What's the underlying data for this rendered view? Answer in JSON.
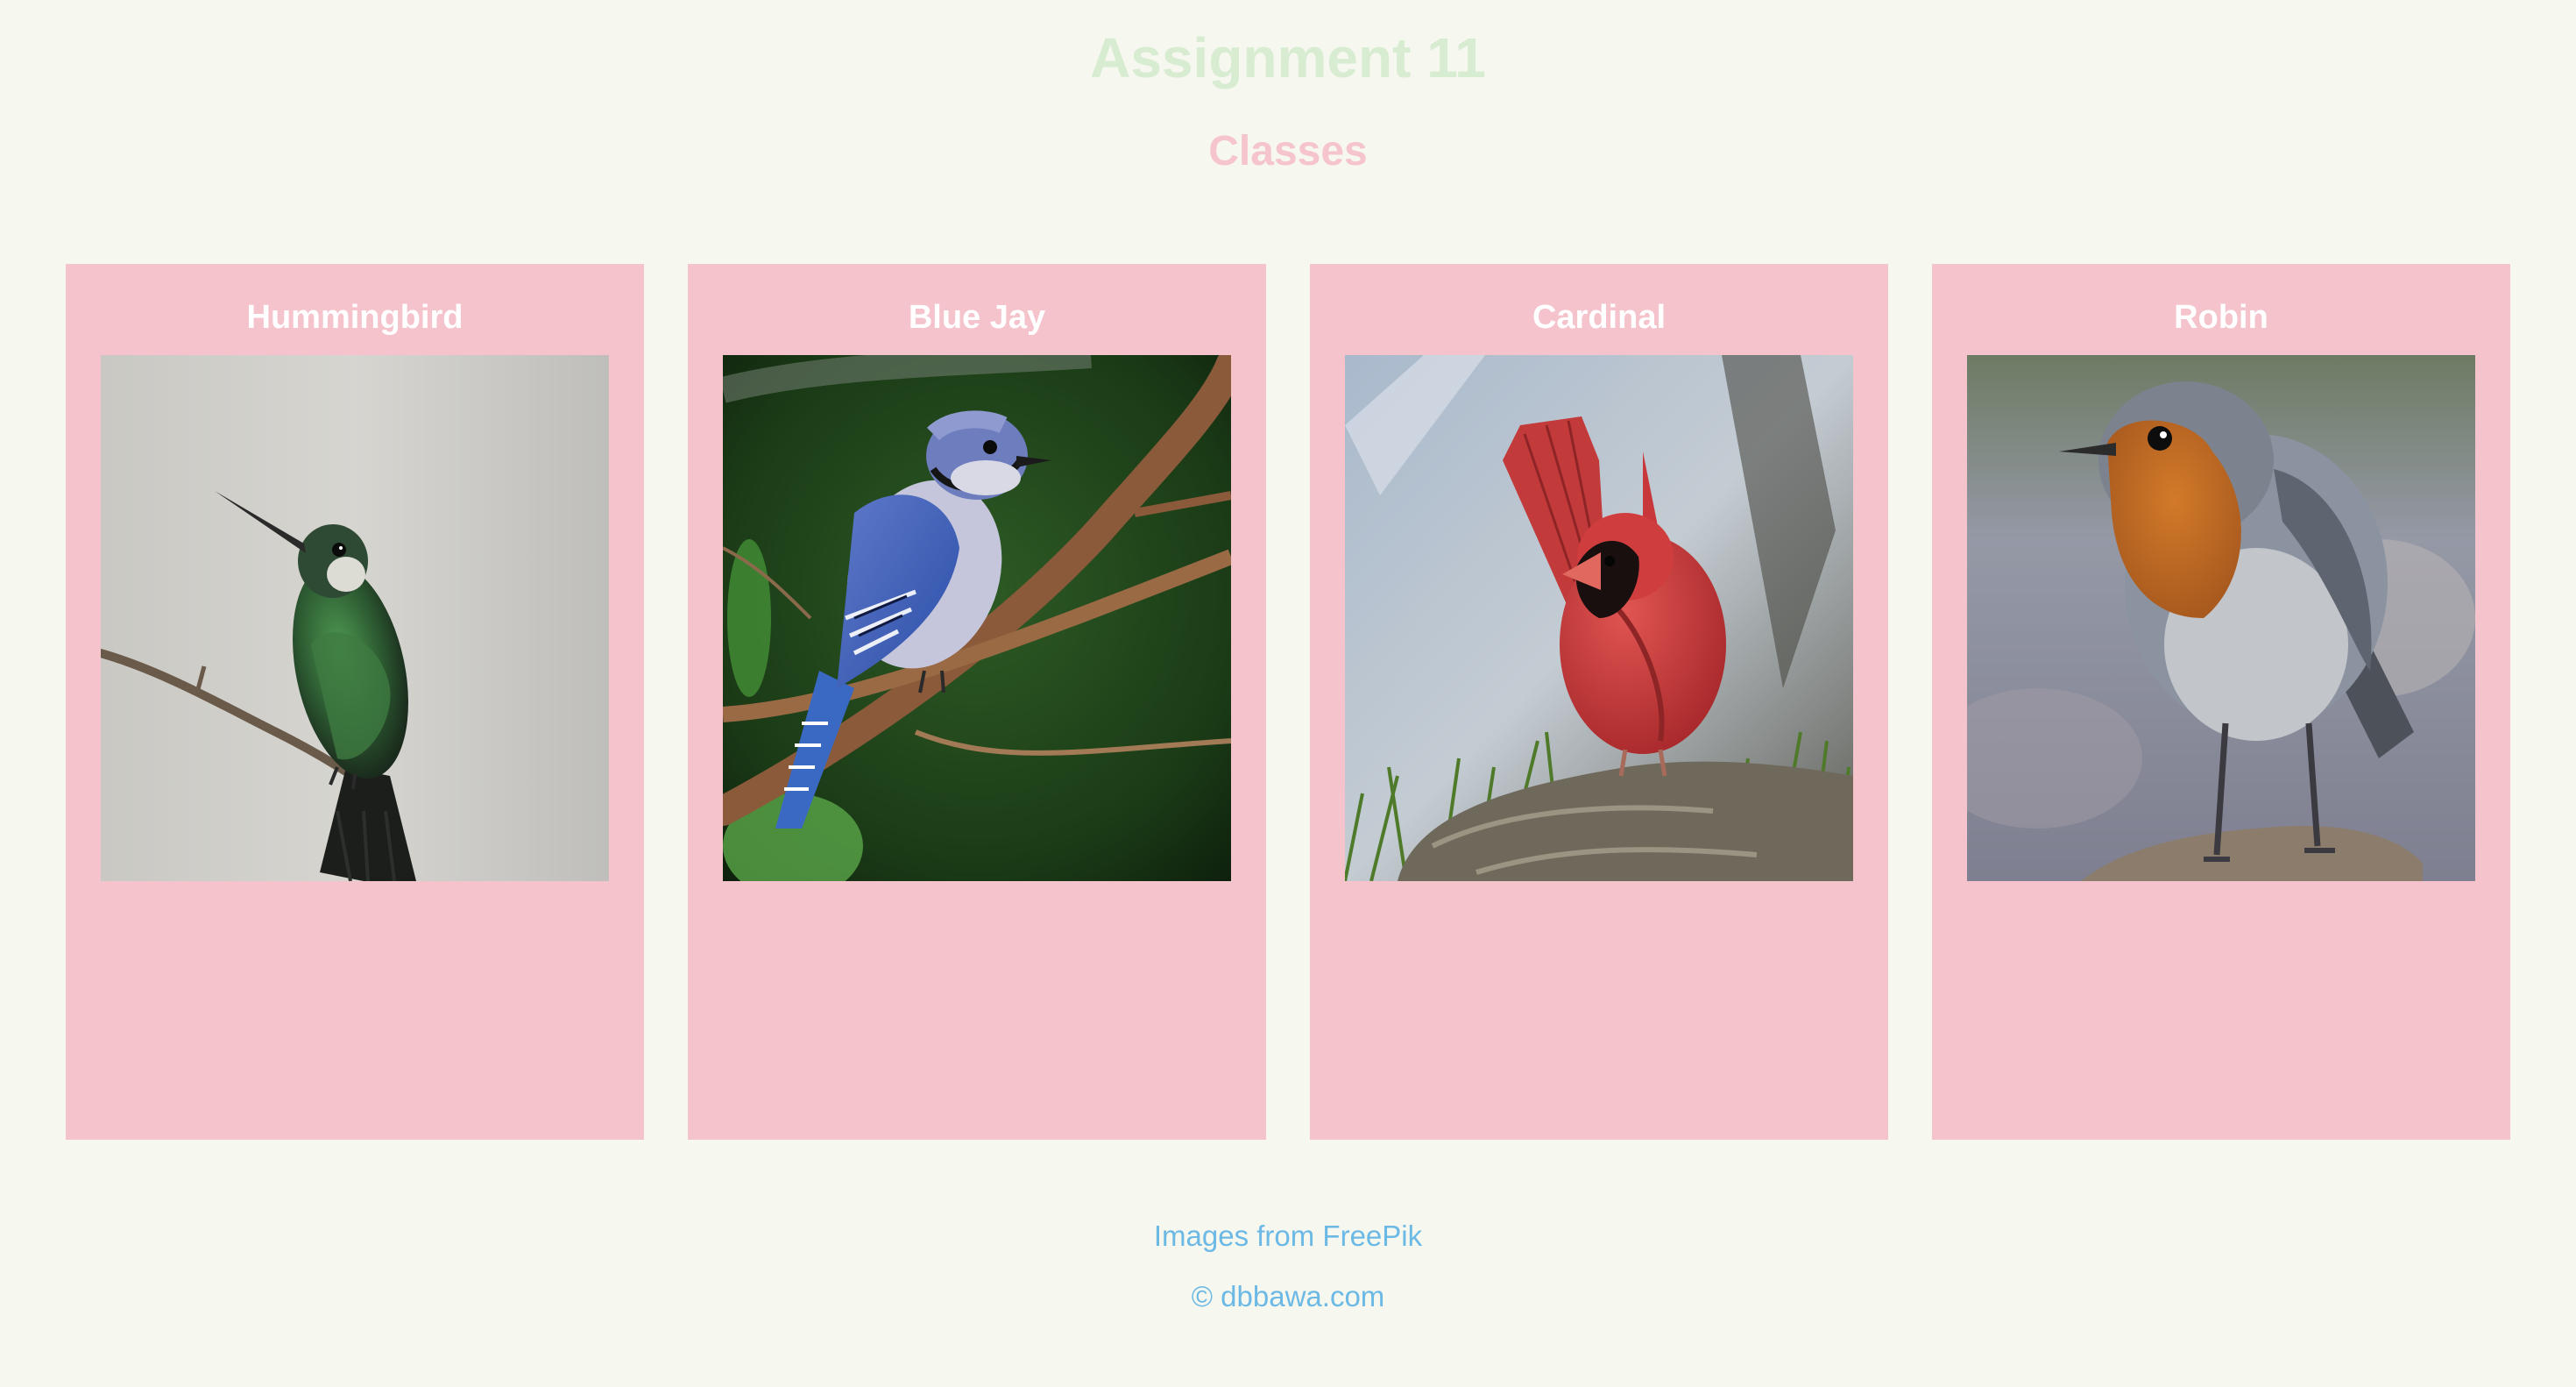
{
  "header": {
    "title": "Assignment 11",
    "subtitle": "Classes"
  },
  "cards": [
    {
      "name": "Hummingbird",
      "image": "hummingbird-photo"
    },
    {
      "name": "Blue Jay",
      "image": "blue-jay-photo"
    },
    {
      "name": "Cardinal",
      "image": "cardinal-photo"
    },
    {
      "name": "Robin",
      "image": "robin-photo"
    }
  ],
  "footer": {
    "credit": "Images from FreePik",
    "copyright": "© dbbawa.com"
  },
  "colors": {
    "background": "#f6f7ef",
    "title": "#d7ecd0",
    "subtitle": "#f5c4cd",
    "card": "#f4c3cc",
    "card_title": "#ffffff",
    "footer_text": "#6bb9e4"
  }
}
